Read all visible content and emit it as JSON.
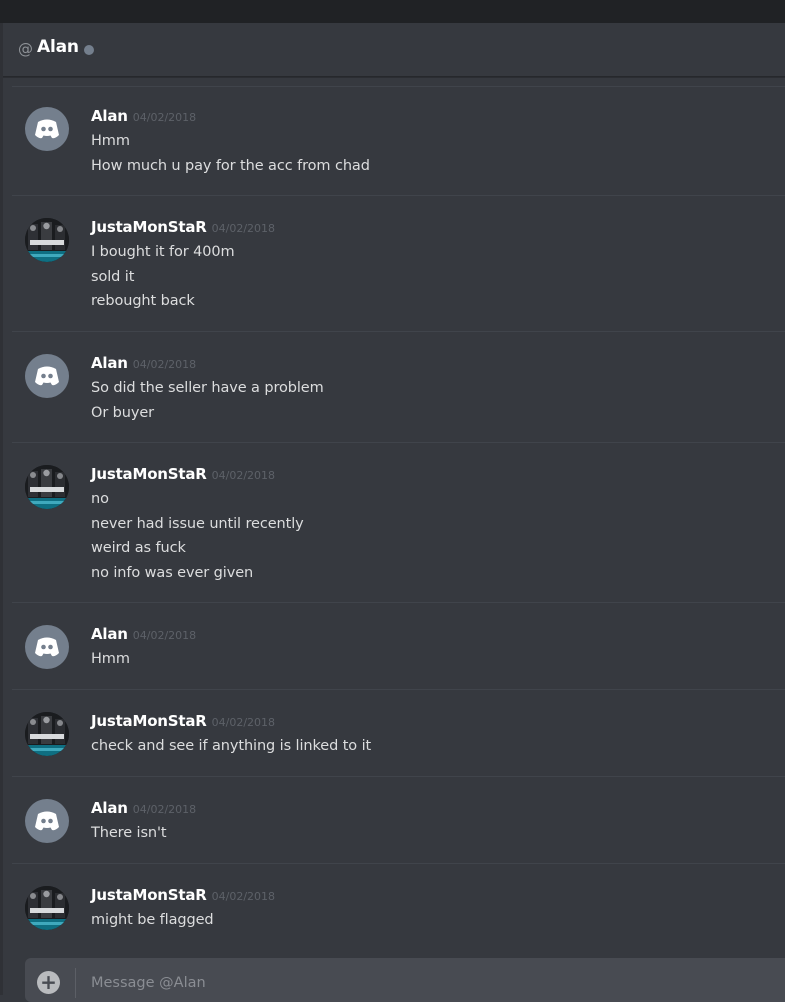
{
  "header": {
    "at_symbol": "@",
    "title": "Alan"
  },
  "composer": {
    "plus_icon": "+",
    "placeholder": "Message @Alan"
  },
  "messages": [
    {
      "author": "Alan",
      "timestamp": "04/02/2018",
      "avatar": "discord-logo-icon",
      "lines": [
        "Hmm",
        "How much u pay for the acc from chad"
      ]
    },
    {
      "author": "JustaMonStaR",
      "timestamp": "04/02/2018",
      "avatar": "user-photo",
      "lines": [
        "I bought it for 400m",
        "sold it",
        "rebought back"
      ]
    },
    {
      "author": "Alan",
      "timestamp": "04/02/2018",
      "avatar": "discord-logo-icon",
      "lines": [
        "So did the seller have a problem",
        "Or buyer"
      ]
    },
    {
      "author": "JustaMonStaR",
      "timestamp": "04/02/2018",
      "avatar": "user-photo",
      "lines": [
        "no",
        "never had issue until recently",
        "weird as fuck",
        "no info was ever given"
      ]
    },
    {
      "author": "Alan",
      "timestamp": "04/02/2018",
      "avatar": "discord-logo-icon",
      "lines": [
        "Hmm"
      ]
    },
    {
      "author": "JustaMonStaR",
      "timestamp": "04/02/2018",
      "avatar": "user-photo",
      "lines": [
        "check and see if anything is linked to it"
      ]
    },
    {
      "author": "Alan",
      "timestamp": "04/02/2018",
      "avatar": "discord-logo-icon",
      "lines": [
        "There isn't"
      ]
    },
    {
      "author": "JustaMonStaR",
      "timestamp": "04/02/2018",
      "avatar": "user-photo",
      "lines": [
        "might be flagged"
      ]
    }
  ],
  "colors": {
    "background": "#36393f",
    "username": "#ffffff",
    "timestamp": "#5d6168",
    "text": "#dcddde",
    "offline": "#747f8d"
  }
}
